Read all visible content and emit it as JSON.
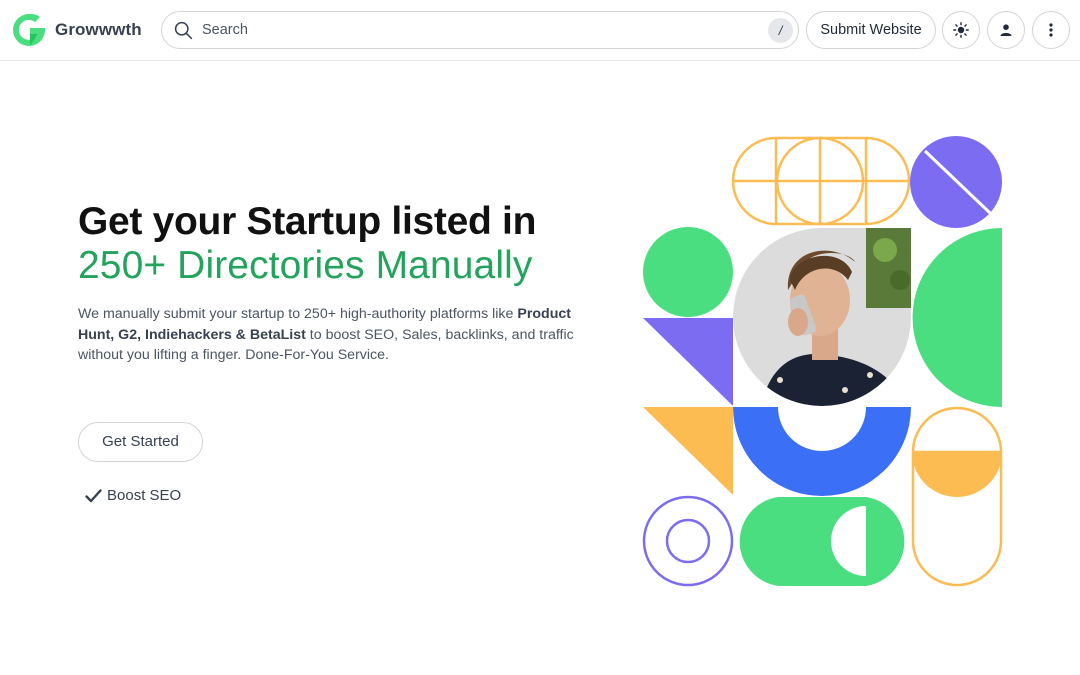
{
  "brand": {
    "name": "Growwwth",
    "color": "#4ade80"
  },
  "search": {
    "placeholder": "Search",
    "shortcut": "/"
  },
  "nav": {
    "submit_label": "Submit Website",
    "theme_icon": "sun-icon",
    "user_icon": "user-icon",
    "menu_icon": "more-vertical-icon"
  },
  "hero": {
    "title_line1": "Get your Startup listed in",
    "title_line2": "250+ Directories Manually",
    "desc_part1": "We manually submit your startup to 250+ high-authority platforms like ",
    "desc_bold": "Product Hunt, G2, Indiehackers & BetaList",
    "desc_part2": " to boost SEO, Sales, backlinks, and traffic without you lifting a finger. Done-For-You Service.",
    "cta_label": "Get Started",
    "feature_label": "Boost SEO",
    "accent": "#22a45d"
  },
  "art_colors": {
    "green": "#4ade80",
    "purple": "#7c6cf2",
    "orange": "#fcbc52",
    "blue": "#3b6ff5"
  }
}
